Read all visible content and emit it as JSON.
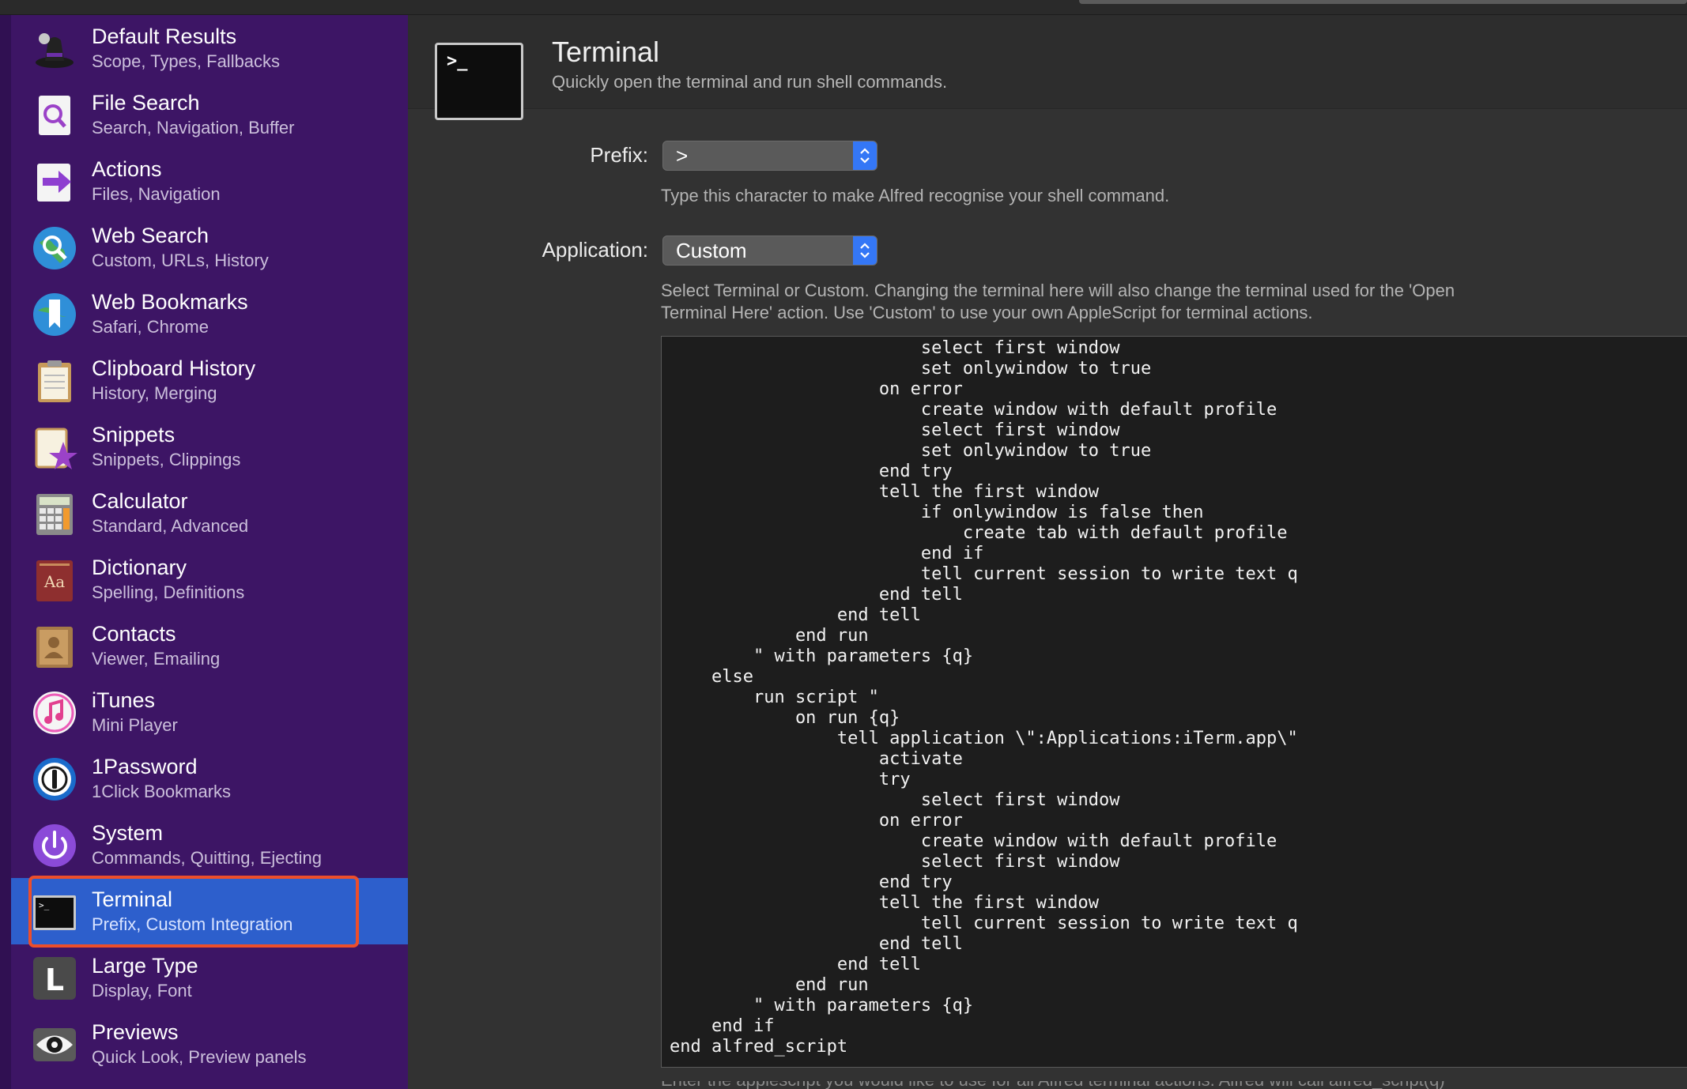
{
  "sidebar": {
    "items": [
      {
        "title": "Default Results",
        "subtitle": "Scope, Types, Fallbacks",
        "icon": "default-results-icon"
      },
      {
        "title": "File Search",
        "subtitle": "Search, Navigation, Buffer",
        "icon": "file-search-icon"
      },
      {
        "title": "Actions",
        "subtitle": "Files, Navigation",
        "icon": "actions-icon"
      },
      {
        "title": "Web Search",
        "subtitle": "Custom, URLs, History",
        "icon": "web-search-icon"
      },
      {
        "title": "Web Bookmarks",
        "subtitle": "Safari, Chrome",
        "icon": "web-bookmarks-icon"
      },
      {
        "title": "Clipboard History",
        "subtitle": "History, Merging",
        "icon": "clipboard-icon"
      },
      {
        "title": "Snippets",
        "subtitle": "Snippets, Clippings",
        "icon": "snippets-icon"
      },
      {
        "title": "Calculator",
        "subtitle": "Standard, Advanced",
        "icon": "calculator-icon"
      },
      {
        "title": "Dictionary",
        "subtitle": "Spelling, Definitions",
        "icon": "dictionary-icon"
      },
      {
        "title": "Contacts",
        "subtitle": "Viewer, Emailing",
        "icon": "contacts-icon"
      },
      {
        "title": "iTunes",
        "subtitle": "Mini Player",
        "icon": "itunes-icon"
      },
      {
        "title": "1Password",
        "subtitle": "1Click Bookmarks",
        "icon": "1password-icon"
      },
      {
        "title": "System",
        "subtitle": "Commands, Quitting, Ejecting",
        "icon": "system-power-icon"
      },
      {
        "title": "Terminal",
        "subtitle": "Prefix, Custom Integration",
        "icon": "terminal-icon"
      },
      {
        "title": "Large Type",
        "subtitle": "Display, Font",
        "icon": "large-type-icon"
      },
      {
        "title": "Previews",
        "subtitle": "Quick Look, Preview panels",
        "icon": "previews-eye-icon"
      }
    ],
    "selected": "Terminal"
  },
  "header": {
    "title": "Terminal",
    "subtitle": "Quickly open the terminal and run shell commands.",
    "icon_text": ">_"
  },
  "form": {
    "prefix_label": "Prefix:",
    "prefix_value": ">",
    "prefix_hint": "Type this character to make Alfred recognise your shell command.",
    "application_label": "Application:",
    "application_value": "Custom",
    "application_hint_1": "Select Terminal or Custom. Changing the terminal here will also change the terminal used for the 'Open",
    "application_hint_2": "Terminal Here' action. Use 'Custom' to use your own AppleScript for terminal actions."
  },
  "code": {
    "text": "                        select first window\n                        set onlywindow to true\n                    on error\n                        create window with default profile\n                        select first window\n                        set onlywindow to true\n                    end try\n                    tell the first window\n                        if onlywindow is false then\n                            create tab with default profile\n                        end if\n                        tell current session to write text q\n                    end tell\n                end tell\n            end run\n        \" with parameters {q}\n    else\n        run script \"\n            on run {q}\n                tell application \\\":Applications:iTerm.app\\\"\n                    activate\n                    try\n                        select first window\n                    on error\n                        create window with default profile\n                        select first window\n                    end try\n                    tell the first window\n                        tell current session to write text q\n                    end tell\n                end tell\n            end run\n        \" with parameters {q}\n    end if\nend alfred_script"
  },
  "footer_cutoff": "Enter the applescript you would like to use for all Alfred terminal actions. Alfred will call alfred_script(q)"
}
